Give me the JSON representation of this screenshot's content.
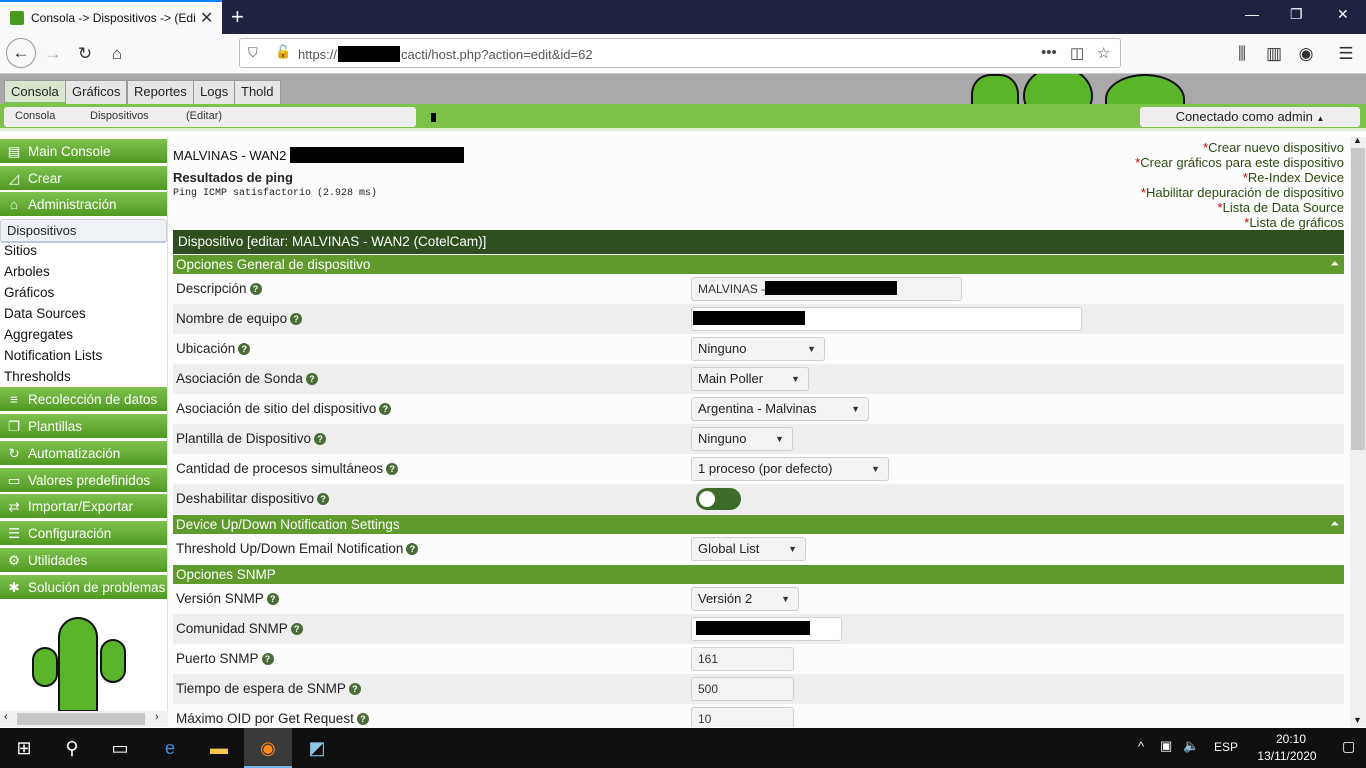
{
  "browser": {
    "tab_title": "Consola -> Dispositivos -> (Editar)",
    "tab_close": "✕",
    "new_tab": "+",
    "url_prefix": "https://",
    "url_suffix": "cacti/host.php?action=edit&id=62",
    "url_more": "•••",
    "window_buttons": [
      "—",
      "❐",
      "✕"
    ]
  },
  "cacti": {
    "tabs": [
      "Consola",
      "Gráficos",
      "Reportes",
      "Logs",
      "Thold"
    ],
    "breadcrumb": [
      "Consola",
      "Dispositivos",
      "(Editar)"
    ],
    "user": "Conectado como admin",
    "user_caret": "▲"
  },
  "sidebar": {
    "menus": [
      {
        "label": "Main Console",
        "icon": "map-icon",
        "glyph": "▤"
      },
      {
        "label": "Crear",
        "icon": "chart-icon",
        "glyph": "◿"
      },
      {
        "label": "Administración",
        "icon": "home-icon",
        "glyph": "⌂"
      }
    ],
    "admin_items": [
      "Dispositivos",
      "Sitios",
      "Arboles",
      "Gráficos",
      "Data Sources",
      "Aggregates",
      "Notification Lists",
      "Thresholds"
    ],
    "menus2": [
      {
        "label": "Recolección de datos",
        "icon": "database-icon",
        "glyph": "≡"
      },
      {
        "label": "Plantillas",
        "icon": "copy-icon",
        "glyph": "❐"
      },
      {
        "label": "Automatización",
        "icon": "refresh-icon",
        "glyph": "↻"
      },
      {
        "label": "Valores predefinidos",
        "icon": "archive-icon",
        "glyph": "▭"
      },
      {
        "label": "Importar/Exportar",
        "icon": "exchange-icon",
        "glyph": "⇄"
      },
      {
        "label": "Configuración",
        "icon": "sliders-icon",
        "glyph": "☰"
      },
      {
        "label": "Utilidades",
        "icon": "cogs-icon",
        "glyph": "⚙"
      },
      {
        "label": "Solución de problemas",
        "icon": "bug-icon",
        "glyph": "✱"
      }
    ]
  },
  "main": {
    "host_title": "MALVINAS - WAN2",
    "ping_heading": "Resultados de ping",
    "ping_result": "Ping ICMP satisfactorio (2.928 ms)",
    "links": [
      "Crear nuevo dispositivo",
      "Crear gráficos para este dispositivo",
      "Re-Index Device",
      "Habilitar depuración de dispositivo",
      "Lista de Data Source",
      "Lista de gráficos"
    ],
    "link_marker": "*",
    "form_title": "Dispositivo [editar: MALVINAS - WAN2 (CotelCam)]",
    "section_general": "Opciones General de dispositivo",
    "section_notify": "Device Up/Down Notification Settings",
    "section_snmp": "Opciones SNMP",
    "collapse_icon": "⏶",
    "fields": {
      "descripcion": {
        "label": "Descripción",
        "value": "MALVINAS -"
      },
      "nombre_equipo": {
        "label": "Nombre de equipo"
      },
      "ubicacion": {
        "label": "Ubicación",
        "value": "Ninguno"
      },
      "sonda": {
        "label": "Asociación de Sonda",
        "value": "Main Poller"
      },
      "sitio": {
        "label": "Asociación de sitio del dispositivo",
        "value": "Argentina - Malvinas"
      },
      "plantilla": {
        "label": "Plantilla de Dispositivo",
        "value": "Ninguno"
      },
      "procesos": {
        "label": "Cantidad de procesos simultáneos",
        "value": "1 proceso (por defecto)"
      },
      "deshabilitar": {
        "label": "Deshabilitar dispositivo"
      },
      "threshold": {
        "label": "Threshold Up/Down Email Notification",
        "value": "Global List"
      },
      "snmp_version": {
        "label": "Versión SNMP",
        "value": "Versión 2"
      },
      "snmp_community": {
        "label": "Comunidad SNMP"
      },
      "snmp_port": {
        "label": "Puerto SNMP",
        "value": "161"
      },
      "snmp_timeout": {
        "label": "Tiempo de espera de SNMP",
        "value": "500"
      },
      "max_oid": {
        "label": "Máximo OID por Get Request",
        "value": "10"
      }
    },
    "help_glyph": "?"
  },
  "taskbar": {
    "lang": "ESP",
    "time": "20:10",
    "date": "13/11/2020"
  },
  "colors": {
    "accent_green": "#5e9a2c",
    "dark_green": "#2f4f1e",
    "link_green": "#2d4a13"
  }
}
